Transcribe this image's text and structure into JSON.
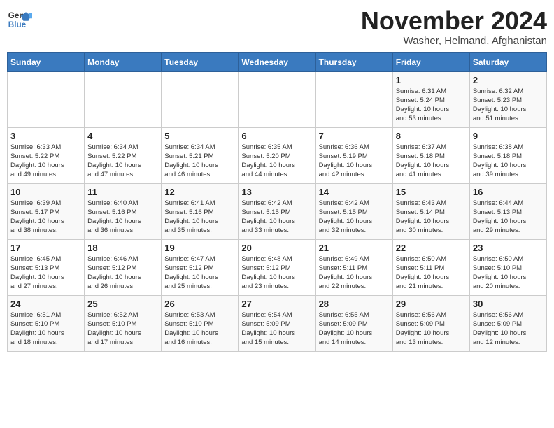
{
  "header": {
    "logo_line1": "General",
    "logo_line2": "Blue",
    "title": "November 2024",
    "subtitle": "Washer, Helmand, Afghanistan"
  },
  "weekdays": [
    "Sunday",
    "Monday",
    "Tuesday",
    "Wednesday",
    "Thursday",
    "Friday",
    "Saturday"
  ],
  "weeks": [
    [
      {
        "day": "",
        "info": ""
      },
      {
        "day": "",
        "info": ""
      },
      {
        "day": "",
        "info": ""
      },
      {
        "day": "",
        "info": ""
      },
      {
        "day": "",
        "info": ""
      },
      {
        "day": "1",
        "info": "Sunrise: 6:31 AM\nSunset: 5:24 PM\nDaylight: 10 hours\nand 53 minutes."
      },
      {
        "day": "2",
        "info": "Sunrise: 6:32 AM\nSunset: 5:23 PM\nDaylight: 10 hours\nand 51 minutes."
      }
    ],
    [
      {
        "day": "3",
        "info": "Sunrise: 6:33 AM\nSunset: 5:22 PM\nDaylight: 10 hours\nand 49 minutes."
      },
      {
        "day": "4",
        "info": "Sunrise: 6:34 AM\nSunset: 5:22 PM\nDaylight: 10 hours\nand 47 minutes."
      },
      {
        "day": "5",
        "info": "Sunrise: 6:34 AM\nSunset: 5:21 PM\nDaylight: 10 hours\nand 46 minutes."
      },
      {
        "day": "6",
        "info": "Sunrise: 6:35 AM\nSunset: 5:20 PM\nDaylight: 10 hours\nand 44 minutes."
      },
      {
        "day": "7",
        "info": "Sunrise: 6:36 AM\nSunset: 5:19 PM\nDaylight: 10 hours\nand 42 minutes."
      },
      {
        "day": "8",
        "info": "Sunrise: 6:37 AM\nSunset: 5:18 PM\nDaylight: 10 hours\nand 41 minutes."
      },
      {
        "day": "9",
        "info": "Sunrise: 6:38 AM\nSunset: 5:18 PM\nDaylight: 10 hours\nand 39 minutes."
      }
    ],
    [
      {
        "day": "10",
        "info": "Sunrise: 6:39 AM\nSunset: 5:17 PM\nDaylight: 10 hours\nand 38 minutes."
      },
      {
        "day": "11",
        "info": "Sunrise: 6:40 AM\nSunset: 5:16 PM\nDaylight: 10 hours\nand 36 minutes."
      },
      {
        "day": "12",
        "info": "Sunrise: 6:41 AM\nSunset: 5:16 PM\nDaylight: 10 hours\nand 35 minutes."
      },
      {
        "day": "13",
        "info": "Sunrise: 6:42 AM\nSunset: 5:15 PM\nDaylight: 10 hours\nand 33 minutes."
      },
      {
        "day": "14",
        "info": "Sunrise: 6:42 AM\nSunset: 5:15 PM\nDaylight: 10 hours\nand 32 minutes."
      },
      {
        "day": "15",
        "info": "Sunrise: 6:43 AM\nSunset: 5:14 PM\nDaylight: 10 hours\nand 30 minutes."
      },
      {
        "day": "16",
        "info": "Sunrise: 6:44 AM\nSunset: 5:13 PM\nDaylight: 10 hours\nand 29 minutes."
      }
    ],
    [
      {
        "day": "17",
        "info": "Sunrise: 6:45 AM\nSunset: 5:13 PM\nDaylight: 10 hours\nand 27 minutes."
      },
      {
        "day": "18",
        "info": "Sunrise: 6:46 AM\nSunset: 5:12 PM\nDaylight: 10 hours\nand 26 minutes."
      },
      {
        "day": "19",
        "info": "Sunrise: 6:47 AM\nSunset: 5:12 PM\nDaylight: 10 hours\nand 25 minutes."
      },
      {
        "day": "20",
        "info": "Sunrise: 6:48 AM\nSunset: 5:12 PM\nDaylight: 10 hours\nand 23 minutes."
      },
      {
        "day": "21",
        "info": "Sunrise: 6:49 AM\nSunset: 5:11 PM\nDaylight: 10 hours\nand 22 minutes."
      },
      {
        "day": "22",
        "info": "Sunrise: 6:50 AM\nSunset: 5:11 PM\nDaylight: 10 hours\nand 21 minutes."
      },
      {
        "day": "23",
        "info": "Sunrise: 6:50 AM\nSunset: 5:10 PM\nDaylight: 10 hours\nand 20 minutes."
      }
    ],
    [
      {
        "day": "24",
        "info": "Sunrise: 6:51 AM\nSunset: 5:10 PM\nDaylight: 10 hours\nand 18 minutes."
      },
      {
        "day": "25",
        "info": "Sunrise: 6:52 AM\nSunset: 5:10 PM\nDaylight: 10 hours\nand 17 minutes."
      },
      {
        "day": "26",
        "info": "Sunrise: 6:53 AM\nSunset: 5:10 PM\nDaylight: 10 hours\nand 16 minutes."
      },
      {
        "day": "27",
        "info": "Sunrise: 6:54 AM\nSunset: 5:09 PM\nDaylight: 10 hours\nand 15 minutes."
      },
      {
        "day": "28",
        "info": "Sunrise: 6:55 AM\nSunset: 5:09 PM\nDaylight: 10 hours\nand 14 minutes."
      },
      {
        "day": "29",
        "info": "Sunrise: 6:56 AM\nSunset: 5:09 PM\nDaylight: 10 hours\nand 13 minutes."
      },
      {
        "day": "30",
        "info": "Sunrise: 6:56 AM\nSunset: 5:09 PM\nDaylight: 10 hours\nand 12 minutes."
      }
    ]
  ]
}
